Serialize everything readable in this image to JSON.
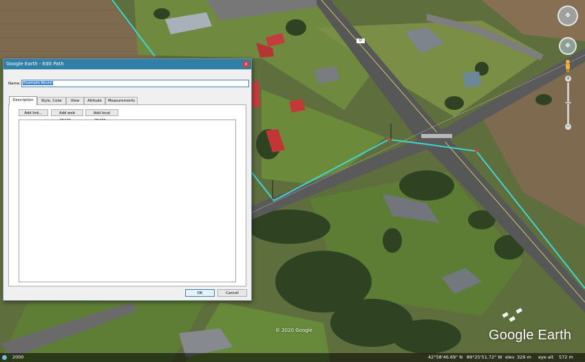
{
  "dialog": {
    "title": "Google Earth - Edit Path",
    "close_glyph": "x",
    "name_label": "Name:",
    "name_value": "Example Route",
    "tabs": [
      {
        "label": "Description",
        "active": true
      },
      {
        "label": "Style, Color",
        "active": false
      },
      {
        "label": "View",
        "active": false
      },
      {
        "label": "Altitude",
        "active": false
      },
      {
        "label": "Measurements",
        "active": false
      }
    ],
    "buttons": {
      "add_link": "Add link...",
      "add_web_image": "Add web image...",
      "add_local_image": "Add local image..."
    },
    "ok_label": "OK",
    "cancel_label": "Cancel"
  },
  "map": {
    "road_label": "D",
    "copyright": "© 2020 Google",
    "logo_text": "Google Earth",
    "path_color": "#3fd6d6"
  },
  "status_bar": {
    "year": "2000",
    "latitude": "42°58'46.69\" N",
    "longitude": "89°25'51.72\" W",
    "elev_label": "elev",
    "elev_value": "329 m",
    "eye_alt_label": "eye alt",
    "eye_alt_value": "572 m"
  },
  "nav": {
    "look_icon": "look-joystick-icon",
    "move_icon": "move-joystick-icon",
    "zoom_in": "+",
    "zoom_out": "−"
  }
}
